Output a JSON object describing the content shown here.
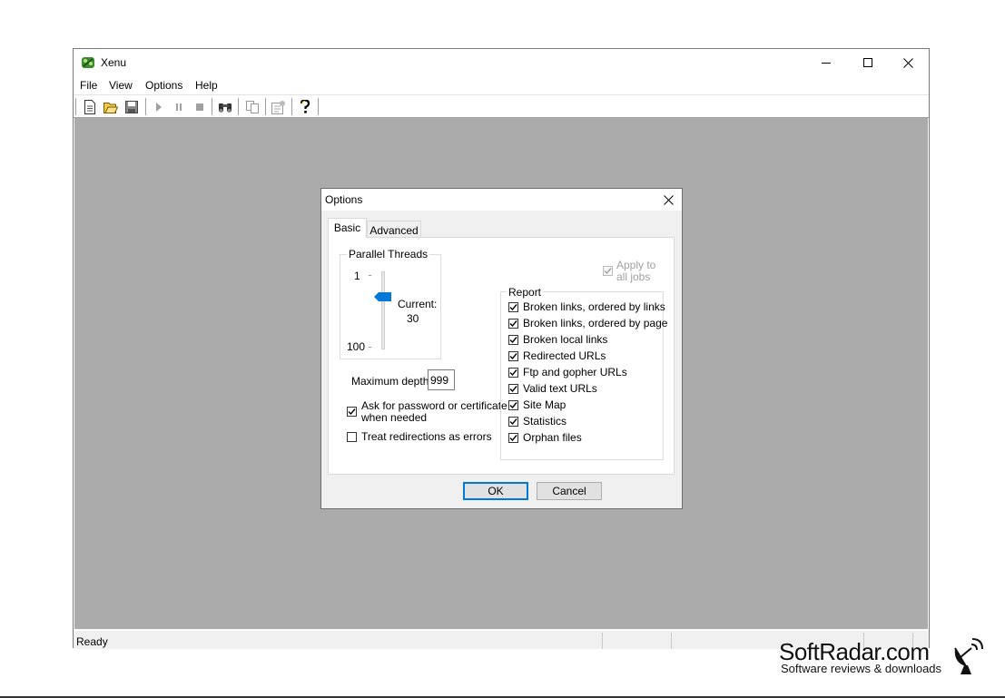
{
  "app": {
    "title": "Xenu"
  },
  "menu": [
    "File",
    "View",
    "Options",
    "Help"
  ],
  "toolbar": {
    "icons": [
      "new-icon",
      "open-icon",
      "save-icon",
      "play-icon",
      "pause-icon",
      "stop-icon",
      "find-icon",
      "copy-icon",
      "properties-icon",
      "help-icon"
    ]
  },
  "status": {
    "text": "Ready"
  },
  "dialog": {
    "title": "Options",
    "tabs": [
      "Basic",
      "Advanced"
    ],
    "threads": {
      "group_label": "Parallel Threads",
      "min_label": "1",
      "max_label": "100",
      "current_label": "Current:",
      "current_value": "30",
      "slider_min": 1,
      "slider_max": 100,
      "slider_value": 30
    },
    "depth": {
      "label": "Maximum depth:",
      "value": "999"
    },
    "ask_password": {
      "label_line1": "Ask for password or certificate",
      "label_line2": "when needed",
      "checked": true
    },
    "treat_redirections": {
      "label": "Treat redirections as errors",
      "checked": false
    },
    "apply_all": {
      "label_line1": "Apply to",
      "label_line2": "all jobs",
      "checked": true,
      "disabled": true
    },
    "report": {
      "group_label": "Report",
      "items": [
        {
          "label": "Broken links, ordered by links",
          "checked": true
        },
        {
          "label": "Broken links, ordered by page",
          "checked": true
        },
        {
          "label": "Broken local links",
          "checked": true
        },
        {
          "label": "Redirected URLs",
          "checked": true
        },
        {
          "label": "Ftp and gopher URLs",
          "checked": true
        },
        {
          "label": "Valid text URLs",
          "checked": true
        },
        {
          "label": "Site Map",
          "checked": true
        },
        {
          "label": "Statistics",
          "checked": true
        },
        {
          "label": "Orphan files",
          "checked": true
        }
      ]
    },
    "buttons": {
      "ok": "OK",
      "cancel": "Cancel"
    }
  },
  "watermark": {
    "brand": "SoftRadar.com",
    "tagline": "Software reviews & downloads"
  },
  "colors": {
    "client_bg": "#ababab",
    "slider_thumb": "#0078d7",
    "focus": "#0078d7"
  }
}
